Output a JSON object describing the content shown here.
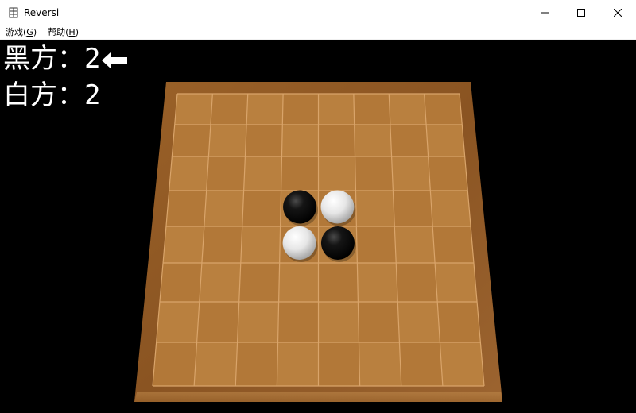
{
  "window": {
    "title": "Reversi",
    "app_icon": "reversi-app-icon"
  },
  "menu": {
    "game": {
      "label": "游戏(",
      "key": "G",
      "suffix": ")"
    },
    "help": {
      "label": "帮助(",
      "key": "H",
      "suffix": ")"
    }
  },
  "score": {
    "black_label": "黑方：",
    "black_count": "2",
    "white_label": "白方：",
    "white_count": "2",
    "turn_indicator": "arrow-left-icon",
    "current_turn": "black"
  },
  "board": {
    "size": 8,
    "pieces": [
      {
        "row": 3,
        "col": 3,
        "color": "black"
      },
      {
        "row": 3,
        "col": 4,
        "color": "white"
      },
      {
        "row": 4,
        "col": 3,
        "color": "white"
      },
      {
        "row": 4,
        "col": 4,
        "color": "black"
      }
    ],
    "colors": {
      "wood_frame": "#8a5523",
      "grid_cell": "#b9803f",
      "grid_line": "#d9a46a"
    }
  }
}
